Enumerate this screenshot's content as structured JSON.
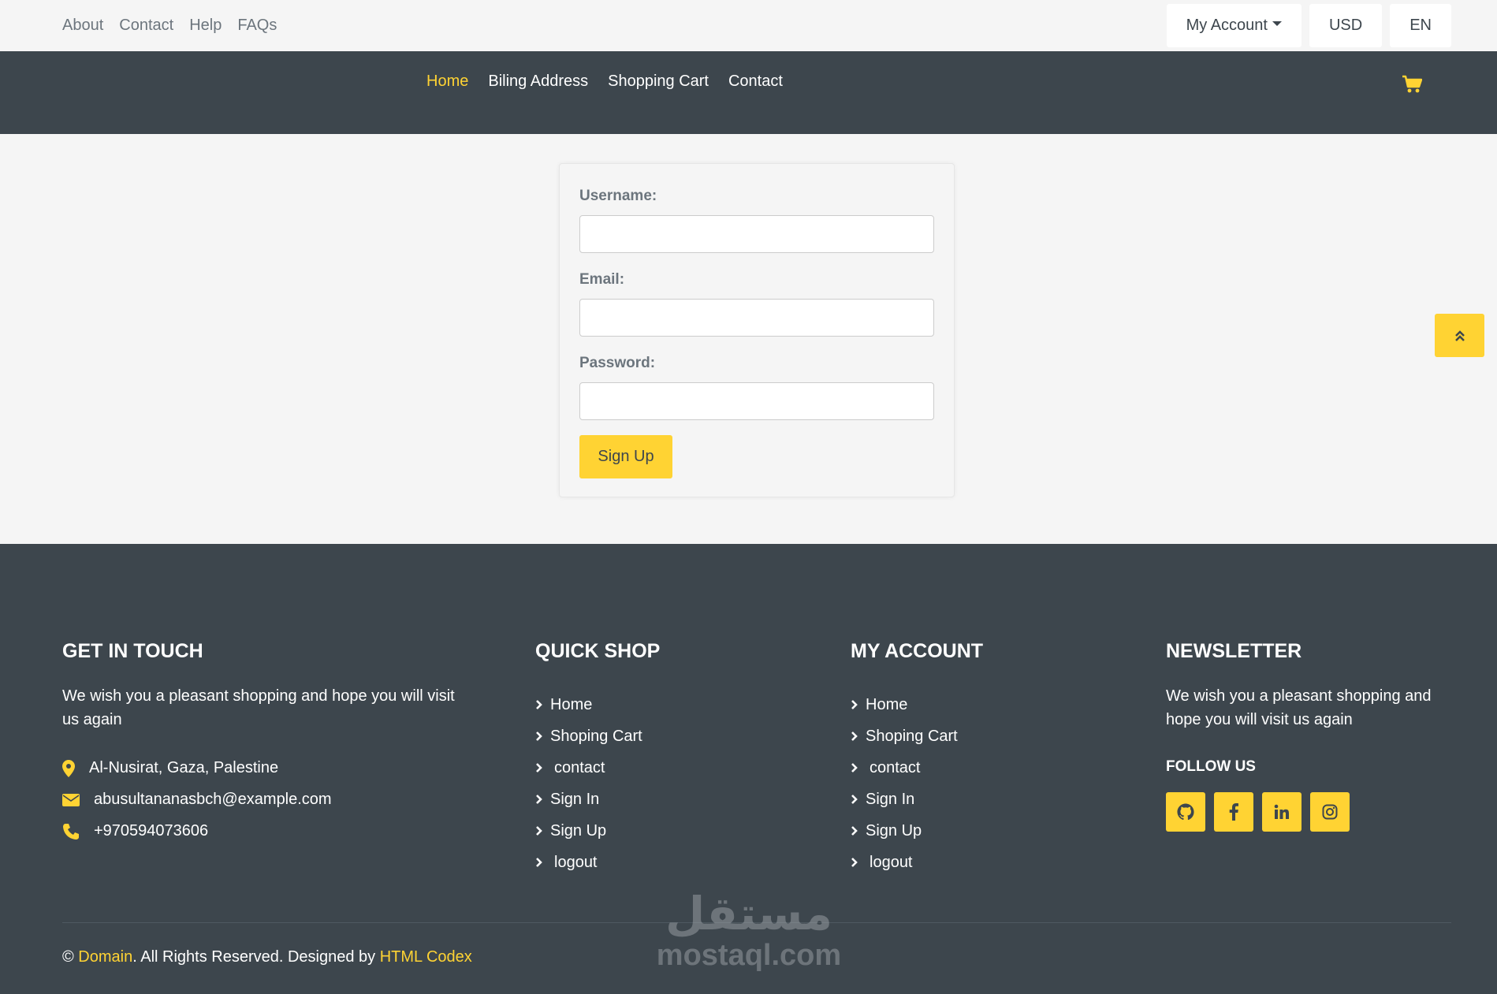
{
  "topbar": {
    "links": [
      "About",
      "Contact",
      "Help",
      "FAQs"
    ],
    "account_label": "My Account",
    "currency_label": "USD",
    "language_label": "EN"
  },
  "navbar": {
    "links": [
      "Home",
      "Biling Address",
      "Shopping Cart",
      "Contact"
    ],
    "active": "Home",
    "cart_icon": "shopping-cart-icon"
  },
  "form": {
    "username_label": "Username:",
    "username_value": "",
    "email_label": "Email:",
    "email_value": "",
    "password_label": "Password:",
    "password_value": "",
    "submit_label": "Sign Up"
  },
  "back_to_top_icon": "double-chevron-up-icon",
  "footer": {
    "get_in_touch": {
      "heading": "GET IN TOUCH",
      "text": "We wish you a pleasant shopping and hope you will visit us again",
      "address": "Al-Nusirat, Gaza, Palestine",
      "email": "abusultananasbch@example.com",
      "phone": "+970594073606"
    },
    "quick_shop": {
      "heading": "QUICK SHOP",
      "items": [
        "Home",
        "Shoping Cart",
        "contact",
        "Sign In",
        "Sign Up",
        "logout"
      ]
    },
    "my_account": {
      "heading": "MY ACCOUNT",
      "items": [
        "Home",
        "Shoping Cart",
        "contact",
        "Sign In",
        "Sign Up",
        "logout"
      ]
    },
    "newsletter": {
      "heading": "NEWSLETTER",
      "text": "We wish you a pleasant shopping and hope you will visit us again",
      "follow_label": "FOLLOW US",
      "socials": [
        "github-icon",
        "facebook-icon",
        "linkedin-icon",
        "instagram-icon"
      ]
    },
    "copyright": {
      "prefix": "© ",
      "domain": "Domain",
      "middle": ". All Rights Reserved. Designed by ",
      "designer": "HTML Codex"
    }
  },
  "watermark": {
    "arabic": "مستقل",
    "latin": "mostaql.com"
  },
  "colors": {
    "accent": "#ffd333",
    "dark": "#3d464d",
    "light": "#f5f5f5",
    "muted": "#6c757d"
  }
}
